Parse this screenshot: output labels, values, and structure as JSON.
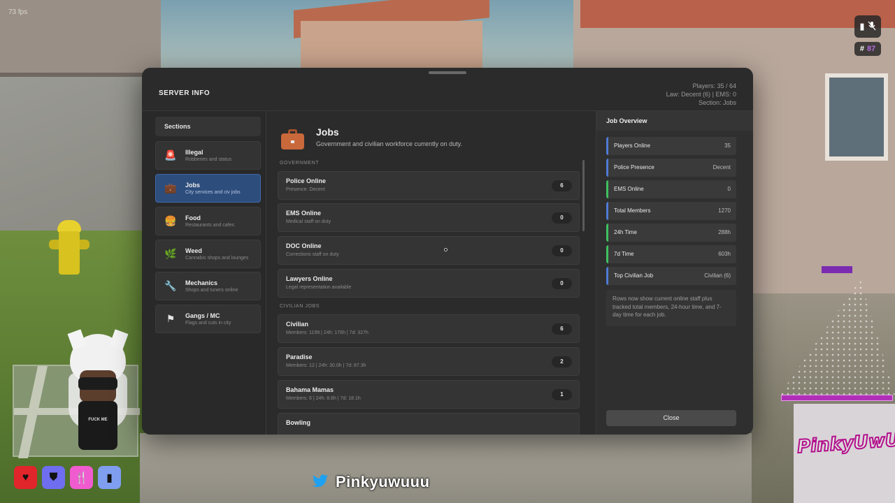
{
  "hud": {
    "fps": "73 fps",
    "player_id": "87",
    "hash": "#"
  },
  "panel": {
    "title": "SERVER INFO",
    "stats": {
      "players": "Players: 35 / 64",
      "law_prefix": "Law: Decent (6)",
      "law_sep": " | ",
      "ems": "EMS: 0",
      "section": "Section: Jobs"
    }
  },
  "sidebar": {
    "header": "Sections",
    "items": [
      {
        "label": "Illegal",
        "sub": "Robberies and status",
        "icon": "siren-icon",
        "glyph": "🚨"
      },
      {
        "label": "Jobs",
        "sub": "City services and civ jobs",
        "icon": "briefcase-icon",
        "glyph": "💼"
      },
      {
        "label": "Food",
        "sub": "Restaurants and cafes",
        "icon": "burger-icon",
        "glyph": "🍔"
      },
      {
        "label": "Weed",
        "sub": "Cannabis shops and lounges",
        "icon": "leaf-icon",
        "glyph": "🌿"
      },
      {
        "label": "Mechanics",
        "sub": "Shops and tuners online",
        "icon": "wrench-icon",
        "glyph": "🔧"
      },
      {
        "label": "Gangs / MC",
        "sub": "Flags and cuts in city",
        "icon": "flag-icon",
        "glyph": "⚑"
      }
    ]
  },
  "content": {
    "title": "Jobs",
    "subtitle": "Government and civilian workforce currently on duty.",
    "groups": {
      "government": "GOVERNMENT",
      "civilian": "CIVILIAN JOBS"
    },
    "government_rows": [
      {
        "label": "Police Online",
        "sub": "Presence: Decent",
        "count": "6"
      },
      {
        "label": "EMS Online",
        "sub": "Medical staff on duty",
        "count": "0"
      },
      {
        "label": "DOC Online",
        "sub": "Corrections staff on duty",
        "count": "0"
      },
      {
        "label": "Lawyers Online",
        "sub": "Legal representation available",
        "count": "0"
      }
    ],
    "civilian_rows": [
      {
        "label": "Civilian",
        "sub": "Members: 1199 | 24h: 176h | 7d: 327h",
        "count": "6"
      },
      {
        "label": "Paradise",
        "sub": "Members: 12 | 24h: 30.0h | 7d: 87.3h",
        "count": "2"
      },
      {
        "label": "Bahama Mamas",
        "sub": "Members: 6 | 24h: 8.6h | 7d: 18.1h",
        "count": "1"
      },
      {
        "label": "Bowling",
        "sub": "",
        "count": ""
      }
    ]
  },
  "overview": {
    "header": "Job Overview",
    "stats": [
      {
        "label": "Players Online",
        "value": "35",
        "color": "#4f7bd6"
      },
      {
        "label": "Police Presence",
        "value": "Decent",
        "color": "#4f7bd6"
      },
      {
        "label": "EMS Online",
        "value": "0",
        "color": "#3fbf5f"
      },
      {
        "label": "Total Members",
        "value": "1270",
        "color": "#4f7bd6"
      },
      {
        "label": "24h Time",
        "value": "288h",
        "color": "#3fbf5f"
      },
      {
        "label": "7d Time",
        "value": "603h",
        "color": "#3fbf5f"
      },
      {
        "label": "Top Civilian Job",
        "value": "Civilian (6)",
        "color": "#4f7bd6"
      }
    ],
    "note": "Rows now show current online staff plus tracked total members, 24-hour time, and 7-day time for each job.",
    "close_label": "Close"
  },
  "status_icons": [
    {
      "name": "heart-icon",
      "glyph": "♥",
      "color": "#e0252b"
    },
    {
      "name": "shield-icon",
      "glyph": "⛊",
      "color": "#6f6ef0"
    },
    {
      "name": "fork-knife-icon",
      "glyph": "🍴",
      "color": "#f15bd0"
    },
    {
      "name": "bottle-icon",
      "glyph": "▮",
      "color": "#7f9ef0"
    }
  ],
  "overlay": {
    "twitter_handle": "Pinkyuwuuu",
    "logo_text": "PinkyUwU",
    "shirt_text": "FUCK ME"
  },
  "colors": {
    "accent_blue": "#2d4d7d",
    "panel_bg": "#2b2b2b",
    "law_highlight": "#b36be0"
  }
}
